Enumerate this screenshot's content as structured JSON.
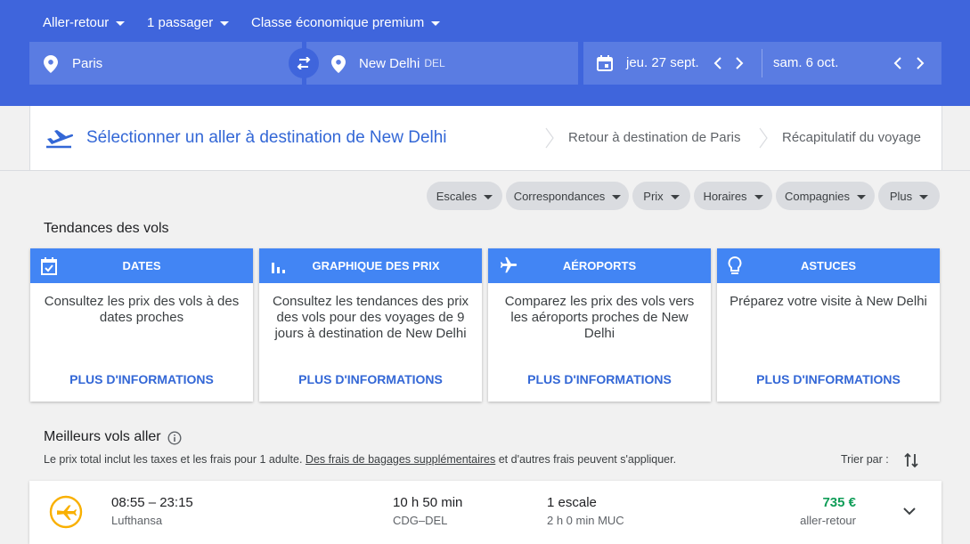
{
  "search": {
    "trip_type": "Aller-retour",
    "passengers": "1 passager",
    "cabin": "Classe économique premium",
    "origin": "Paris",
    "destination": "New Delhi",
    "destination_code": "DEL",
    "depart_date": "jeu. 27 sept.",
    "return_date": "sam. 6 oct."
  },
  "steps": {
    "current": "Sélectionner un aller à destination de New Delhi",
    "return": "Retour à destination de Paris",
    "summary": "Récapitulatif du voyage"
  },
  "filters": [
    "Escales",
    "Correspondances",
    "Prix",
    "Horaires",
    "Compagnies",
    "Plus"
  ],
  "trends": {
    "title": "Tendances des vols",
    "cards": [
      {
        "title": "DATES",
        "icon": "calendar-check-icon",
        "text": "Consultez les prix des vols à des dates proches",
        "link": "PLUS D'INFORMATIONS"
      },
      {
        "title": "GRAPHIQUE DES PRIX",
        "icon": "bar-chart-icon",
        "text": "Consultez les tendances des prix des vols pour des voyages de 9 jours à destination de New Delhi",
        "link": "PLUS D'INFORMATIONS"
      },
      {
        "title": "AÉROPORTS",
        "icon": "airplane-icon",
        "text": "Comparez les prix des vols vers les aéroports proches de New Delhi",
        "link": "PLUS D'INFORMATIONS"
      },
      {
        "title": "ASTUCES",
        "icon": "lightbulb-icon",
        "text": "Préparez votre visite à New Delhi",
        "link": "PLUS D'INFORMATIONS"
      }
    ]
  },
  "best": {
    "title": "Meilleurs vols aller",
    "info_prefix": "Le prix total inclut les taxes et les frais pour 1 adulte.",
    "info_link": "Des frais de bagages supplémentaires",
    "info_suffix": "et d'autres frais peuvent s'appliquer.",
    "sort_label": "Trier par :"
  },
  "flights": [
    {
      "times": "08:55 – 23:15",
      "airline": "Lufthansa",
      "duration": "10 h 50 min",
      "route": "CDG–DEL",
      "stops": "1 escale",
      "layover": "2 h 0 min MUC",
      "price": "735 €",
      "price_type": "aller-retour"
    }
  ],
  "colors": {
    "header": "#3f65dc",
    "accent": "#4285f4",
    "link": "#3367d6",
    "price": "#0f9d58"
  }
}
